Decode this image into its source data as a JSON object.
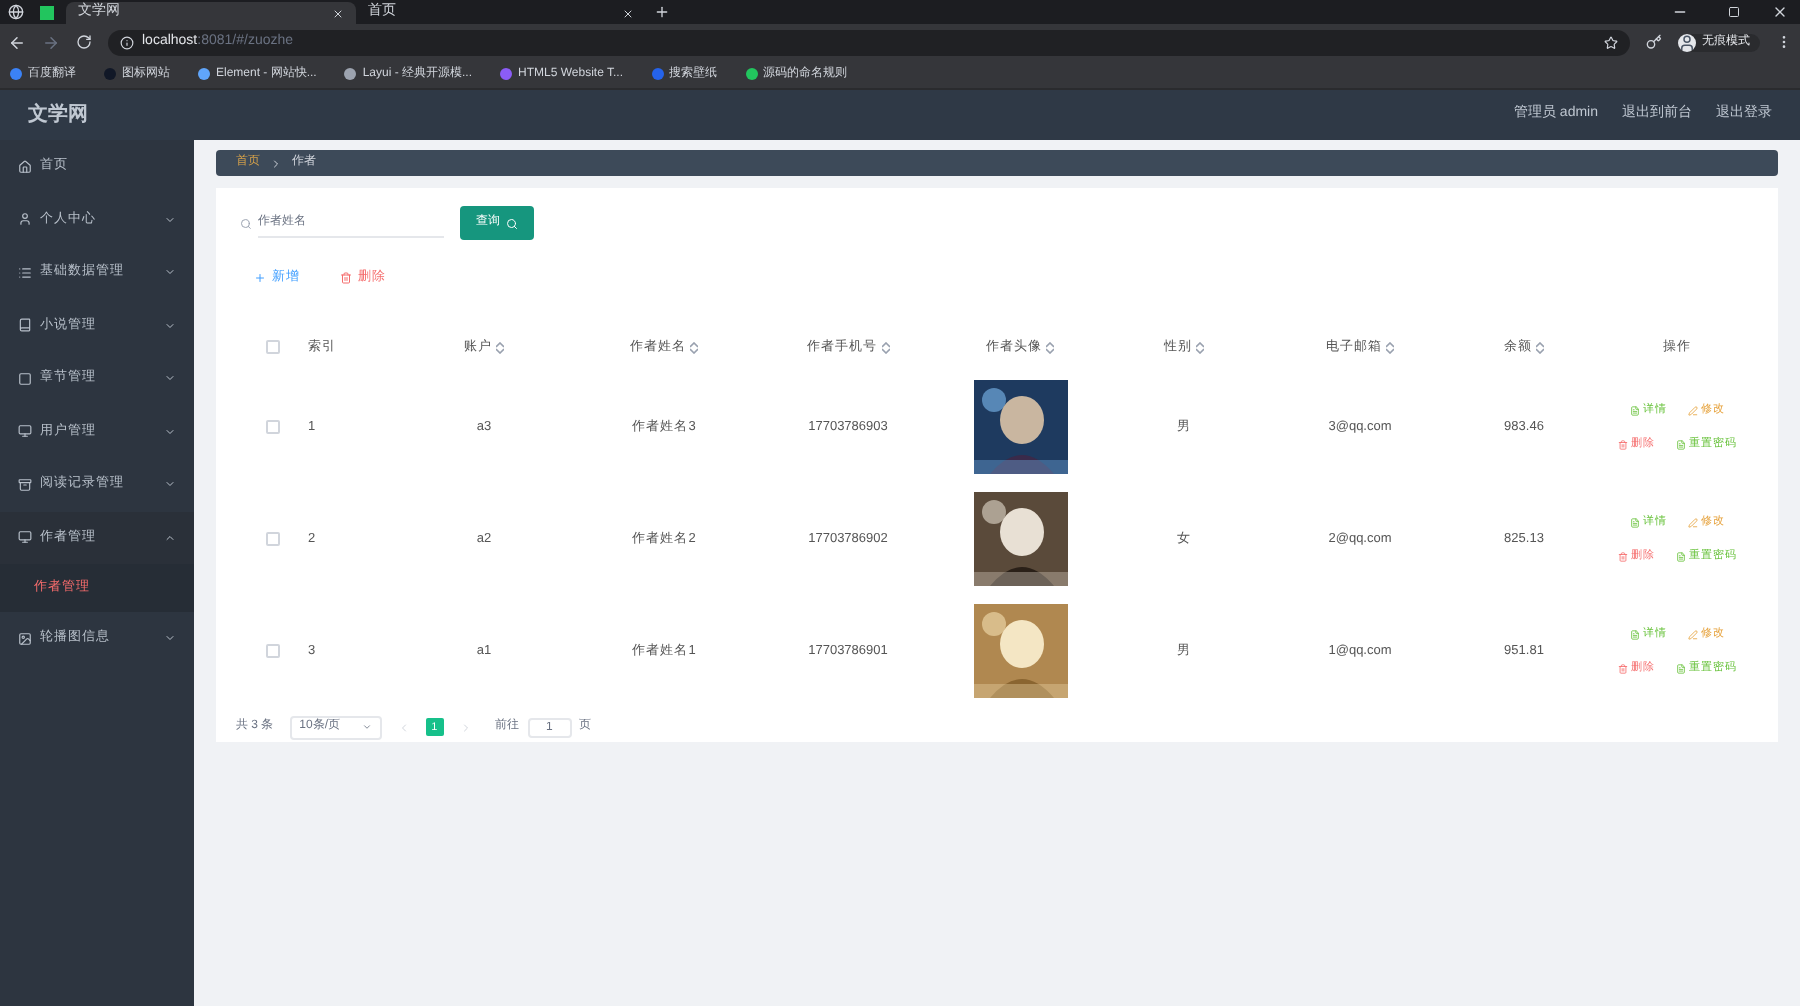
{
  "browser": {
    "tabs": [
      {
        "title": "文学网",
        "selected": true
      },
      {
        "title": "首页",
        "selected": false
      }
    ],
    "url_host": "localhost",
    "url_rest": ":8081/#/zuozhe",
    "bookmarks": [
      "百度翻译",
      "图标网站",
      "Element - 网站快...",
      "Layui - 经典开源模...",
      "HTML5 Website T...",
      "搜索壁纸",
      "源码的命名规则"
    ],
    "profile": "无痕模式"
  },
  "header": {
    "title": "文学网",
    "links": [
      "管理员 admin",
      "退出到前台",
      "退出登录"
    ]
  },
  "sidebar": {
    "items": [
      {
        "label": "首页",
        "kind": "link"
      },
      {
        "label": "个人中心",
        "kind": "menu",
        "expanded": false
      },
      {
        "label": "基础数据管理",
        "kind": "menu",
        "expanded": false
      },
      {
        "label": "小说管理",
        "kind": "menu",
        "expanded": false
      },
      {
        "label": "章节管理",
        "kind": "menu",
        "expanded": false
      },
      {
        "label": "用户管理",
        "kind": "menu",
        "expanded": false
      },
      {
        "label": "阅读记录管理",
        "kind": "menu",
        "expanded": false
      },
      {
        "label": "作者管理",
        "kind": "menu",
        "expanded": true,
        "children": [
          {
            "label": "作者管理",
            "selected": true
          }
        ]
      },
      {
        "label": "轮播图信息",
        "kind": "menu",
        "expanded": false
      }
    ]
  },
  "breadcrumb": [
    "首页",
    "作者"
  ],
  "search": {
    "placeholder": "作者姓名",
    "button": "查询"
  },
  "toolbar": {
    "add": "新增",
    "delete": "删除"
  },
  "table": {
    "all_checked": false,
    "columns": [
      {
        "label": "索引",
        "sortable": false
      },
      {
        "label": "账户",
        "sortable": true
      },
      {
        "label": "作者姓名",
        "sortable": true
      },
      {
        "label": "作者手机号",
        "sortable": true
      },
      {
        "label": "作者头像",
        "sortable": true
      },
      {
        "label": "性别",
        "sortable": true
      },
      {
        "label": "电子邮箱",
        "sortable": true
      },
      {
        "label": "余额",
        "sortable": true
      },
      {
        "label": "操作",
        "sortable": false
      }
    ],
    "rows": [
      {
        "index": "1",
        "account": "a3",
        "name": "作者姓名3",
        "phone": "17703786903",
        "gender": "男",
        "email": "3@qq.com",
        "balance": "983.46",
        "checked": false,
        "actions": [
          {
            "label": "详情",
            "kind": "detail"
          },
          {
            "label": "修改",
            "kind": "edit"
          },
          {
            "label": "删除",
            "kind": "delete"
          },
          {
            "label": "重置密码",
            "kind": "reset"
          }
        ]
      },
      {
        "index": "2",
        "account": "a2",
        "name": "作者姓名2",
        "phone": "17703786902",
        "gender": "女",
        "email": "2@qq.com",
        "balance": "825.13",
        "checked": false,
        "actions": [
          {
            "label": "详情",
            "kind": "detail"
          },
          {
            "label": "修改",
            "kind": "edit"
          },
          {
            "label": "删除",
            "kind": "delete"
          },
          {
            "label": "重置密码",
            "kind": "reset"
          }
        ]
      },
      {
        "index": "3",
        "account": "a1",
        "name": "作者姓名1",
        "phone": "17703786901",
        "gender": "男",
        "email": "1@qq.com",
        "balance": "951.81",
        "checked": false,
        "actions": [
          {
            "label": "详情",
            "kind": "detail"
          },
          {
            "label": "修改",
            "kind": "edit"
          },
          {
            "label": "删除",
            "kind": "delete"
          },
          {
            "label": "重置密码",
            "kind": "reset"
          }
        ]
      }
    ]
  },
  "pagination": {
    "total": "共 3 条",
    "page_size": "10条/页",
    "pages": [
      {
        "label": "1",
        "selected": true
      }
    ],
    "goto_label": "前往",
    "goto_value": "1",
    "goto_suffix": "页"
  }
}
